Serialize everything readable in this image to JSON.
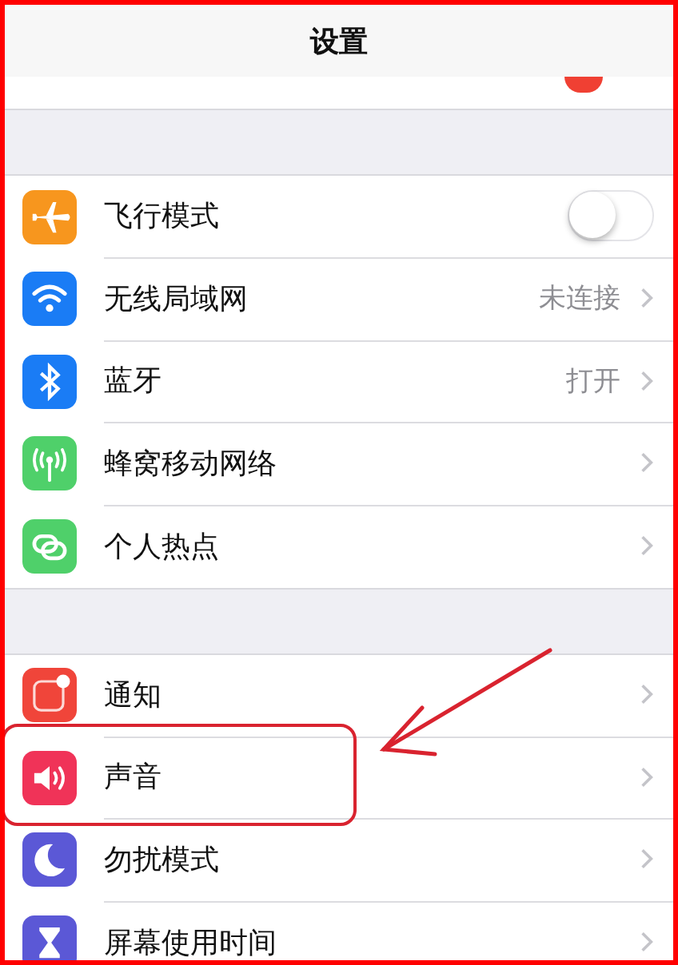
{
  "title": "设置",
  "sections": [
    {
      "rows": [
        {
          "kind": "toggle",
          "label": "飞行模式",
          "on": false,
          "highlighted": false
        },
        {
          "kind": "link",
          "label": "无线局域网",
          "value": "未连接",
          "highlighted": false
        },
        {
          "kind": "link",
          "label": "蓝牙",
          "value": "打开",
          "highlighted": false
        },
        {
          "kind": "link",
          "label": "蜂窝移动网络",
          "highlighted": false
        },
        {
          "kind": "link",
          "label": "个人热点",
          "highlighted": false
        }
      ]
    },
    {
      "rows": [
        {
          "kind": "link",
          "label": "通知",
          "highlighted": false
        },
        {
          "kind": "link",
          "label": "声音",
          "highlighted": true
        },
        {
          "kind": "link",
          "label": "勿扰模式",
          "highlighted": false
        },
        {
          "kind": "link",
          "label": "屏幕使用时间",
          "highlighted": false
        }
      ]
    }
  ]
}
